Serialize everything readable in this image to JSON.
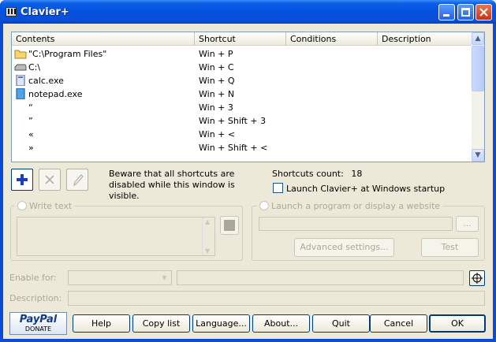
{
  "window": {
    "title": "Clavier+"
  },
  "list": {
    "columns": [
      "Contents",
      "Shortcut",
      "Conditions",
      "Description"
    ],
    "rows": [
      {
        "icon": "folder-icon",
        "contents": "\"C:\\Program Files\"",
        "shortcut": "Win + P"
      },
      {
        "icon": "drive-icon",
        "contents": "C:\\",
        "shortcut": "Win + C"
      },
      {
        "icon": "exe-icon",
        "contents": "calc.exe",
        "shortcut": "Win + Q"
      },
      {
        "icon": "notepad-icon",
        "contents": "notepad.exe",
        "shortcut": "Win + N"
      },
      {
        "icon": "",
        "contents": "“",
        "shortcut": "Win + 3"
      },
      {
        "icon": "",
        "contents": "”",
        "shortcut": "Win + Shift + 3"
      },
      {
        "icon": "",
        "contents": "«",
        "shortcut": "Win + <"
      },
      {
        "icon": "",
        "contents": "»",
        "shortcut": "Win + Shift + <"
      }
    ]
  },
  "info": {
    "note": "Beware that all shortcuts are disabled while this window is visible.",
    "count_label": "Shortcuts count:",
    "count": "18",
    "startup_label": "Launch Clavier+ at Windows startup"
  },
  "write_text": {
    "label": "Write text"
  },
  "launch": {
    "label": "Launch a program or display a website",
    "browse": "...",
    "advanced": "Advanced settings...",
    "test": "Test"
  },
  "fields": {
    "enable_for": "Enable for:",
    "description": "Description:"
  },
  "buttons": {
    "donate_top": "PayPal",
    "donate_bottom": "DONATE",
    "help": "Help",
    "copy_list": "Copy list",
    "language": "Language...",
    "about": "About...",
    "quit": "Quit",
    "cancel": "Cancel",
    "ok": "OK"
  }
}
